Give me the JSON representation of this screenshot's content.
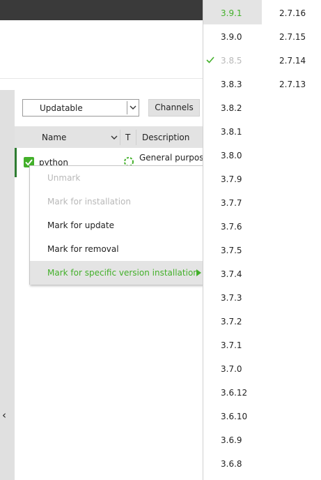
{
  "colors": {
    "accent_green": "#43b02a",
    "dark_bar": "#3a3a3a",
    "disabled_text": "#b8b8b8",
    "highlight_bg": "#e4e4e4"
  },
  "filter": {
    "selected": "Updatable"
  },
  "toolbar": {
    "channels_label": "Channels"
  },
  "table": {
    "columns": {
      "name": "Name",
      "type": "T",
      "description": "Description"
    },
    "rows": [
      {
        "name": "python",
        "description": "General purpose",
        "marked": true
      }
    ]
  },
  "context_menu": {
    "items": [
      {
        "label": "Unmark",
        "enabled": false
      },
      {
        "label": "Mark for installation",
        "enabled": false
      },
      {
        "label": "Mark for update",
        "enabled": true
      },
      {
        "label": "Mark for removal",
        "enabled": true
      },
      {
        "label": "Mark for specific version installation",
        "enabled": true,
        "highlighted": true,
        "has_submenu": true
      }
    ]
  },
  "versions": {
    "highlighted": "3.9.1",
    "installed": "3.8.5",
    "column_1": [
      "3.9.1",
      "3.9.0",
      "3.8.5",
      "3.8.3",
      "3.8.2",
      "3.8.1",
      "3.8.0",
      "3.7.9",
      "3.7.7",
      "3.7.6",
      "3.7.5",
      "3.7.4",
      "3.7.3",
      "3.7.2",
      "3.7.1",
      "3.7.0",
      "3.6.12",
      "3.6.10",
      "3.6.9",
      "3.6.8"
    ],
    "column_2": [
      "2.7.16",
      "2.7.15",
      "2.7.14",
      "2.7.13"
    ]
  },
  "icons": {
    "collapse": "chevron-left-icon",
    "filter_dropdown": "chevron-down-icon",
    "checkbox": "checkbox-checked-icon",
    "package_type": "package-loading-icon",
    "submenu": "submenu-arrow-icon",
    "installed": "checkmark-icon"
  }
}
